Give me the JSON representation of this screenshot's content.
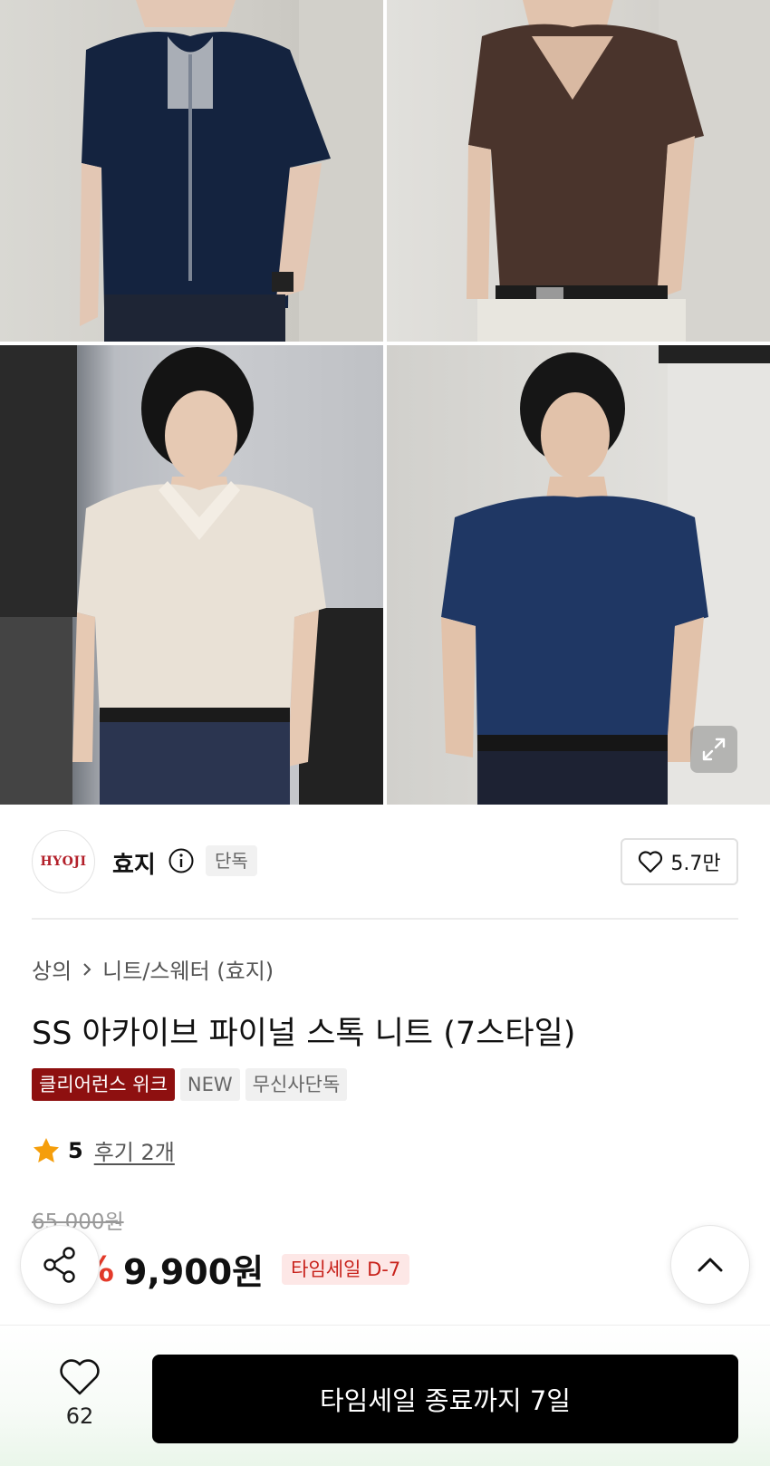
{
  "gallery": {
    "images": [
      {
        "alt": "navy zip knit"
      },
      {
        "alt": "brown cable v-neck knit"
      },
      {
        "alt": "beige collar knit"
      },
      {
        "alt": "navy cable knit"
      }
    ],
    "expand_icon": "expand-icon"
  },
  "brand": {
    "logo_text": "HYOJI",
    "name": "효지",
    "badge": "단독",
    "like_count": "5.7만"
  },
  "breadcrumb": {
    "level1": "상의",
    "level2": "니트/스웨터 (효지)"
  },
  "product": {
    "title": "SS 아카이브 파이널 스톡 니트 (7스타일)",
    "tags": [
      "클리어런스 위크",
      "NEW",
      "무신사단독"
    ],
    "rating": "5",
    "reviews": "후기 2개",
    "original_price": "65,000원",
    "discount": "85%",
    "price": "9,900원",
    "timesale": "타임세일 D-7"
  },
  "bottom": {
    "like_count": "62",
    "buy_label": "타임세일 종료까지 7일"
  },
  "colors": {
    "accent_red": "#e43a2a",
    "tag_red": "#8e1010",
    "star": "#f59e0b"
  }
}
